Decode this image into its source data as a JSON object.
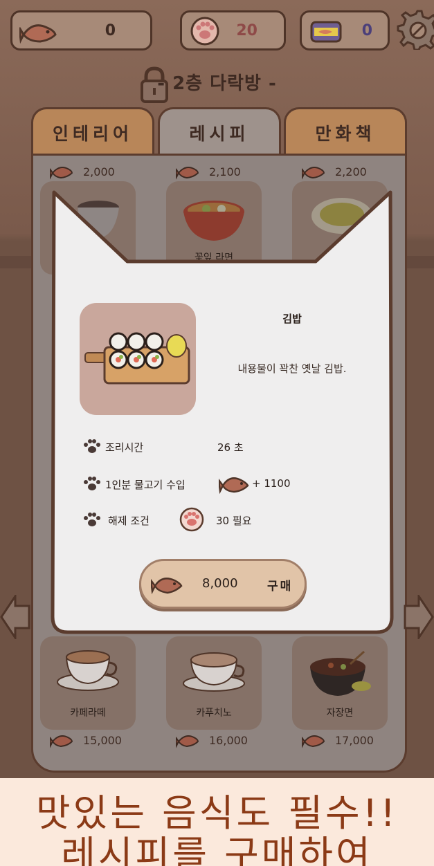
{
  "hud": {
    "fish_count": "0",
    "paw_count": "20",
    "can_count": "0"
  },
  "floor": {
    "title": "- 2층 다락방 -"
  },
  "tabs": [
    {
      "label": "인테리어"
    },
    {
      "label": "레시피"
    },
    {
      "label": "만화책"
    }
  ],
  "recipes_top": [
    {
      "price": "2,000",
      "name": ""
    },
    {
      "price": "2,100",
      "name": "꽃잎 라면"
    },
    {
      "price": "2,200",
      "name": ""
    }
  ],
  "recipes_bottom": [
    {
      "price": "15,000",
      "name": "카페라떼"
    },
    {
      "price": "16,000",
      "name": "카푸치노"
    },
    {
      "price": "17,000",
      "name": "자장면"
    }
  ],
  "modal": {
    "name": "김밥",
    "description": "내용물이 꽉찬 옛날 김밥.",
    "cook_time_label": "조리시간",
    "cook_time_value": "26 초",
    "income_label": "1인분 물고기 수입",
    "income_value": "+ 1100",
    "unlock_label": "해제 조건",
    "unlock_value": "30 필요",
    "buy_price": "8,000",
    "buy_label": "구매"
  },
  "banner": {
    "line1": "맛있는 음식도 필수!!",
    "line2": "레시피를 구매하여"
  },
  "icons": {
    "fish": "fish-icon",
    "paw": "paw-icon",
    "can": "can-icon",
    "gear": "gear-icon",
    "lock": "lock-icon"
  }
}
